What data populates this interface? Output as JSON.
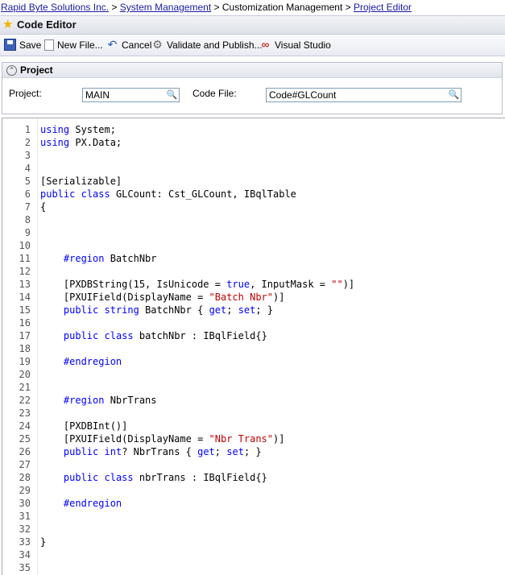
{
  "breadcrumb": {
    "crumb1": "Rapid Byte Solutions Inc.",
    "crumb2": "System Management",
    "crumb3": "Customization Management",
    "crumb4": "Project Editor",
    "separator": ">"
  },
  "header": {
    "title": "Code Editor"
  },
  "toolbar": {
    "save": "Save",
    "new_file": "New File...",
    "cancel": "Cancel",
    "validate": "Validate and Publish...",
    "visual_studio": "Visual Studio"
  },
  "project_panel": {
    "title": "Project",
    "project_label": "Project:",
    "project_value": "MAIN",
    "code_file_label": "Code File:",
    "code_file_value": "Code#GLCount"
  },
  "colors": {
    "keyword": "#0000ff",
    "string": "#c00000",
    "link": "#1a1aa6"
  },
  "code_lines": [
    [
      [
        "kw",
        "using"
      ],
      [
        "pl",
        " System;"
      ]
    ],
    [
      [
        "kw",
        "using"
      ],
      [
        "pl",
        " PX.Data;"
      ]
    ],
    [],
    [],
    [
      [
        "pl",
        "[Serializable]"
      ]
    ],
    [
      [
        "kw",
        "public"
      ],
      [
        "pl",
        " "
      ],
      [
        "kw",
        "class"
      ],
      [
        "pl",
        " GLCount: Cst_GLCount, IBqlTable"
      ]
    ],
    [
      [
        "pl",
        "{"
      ]
    ],
    [],
    [],
    [],
    [
      [
        "pl",
        "    "
      ],
      [
        "kw",
        "#region"
      ],
      [
        "pl",
        " BatchNbr"
      ]
    ],
    [],
    [
      [
        "pl",
        "    [PXDBString(15, IsUnicode = "
      ],
      [
        "kw",
        "true"
      ],
      [
        "pl",
        ", InputMask = "
      ],
      [
        "str",
        "\"\""
      ],
      [
        "pl",
        ")]"
      ]
    ],
    [
      [
        "pl",
        "    [PXUIField(DisplayName = "
      ],
      [
        "str",
        "\"Batch Nbr\""
      ],
      [
        "pl",
        ")]"
      ]
    ],
    [
      [
        "pl",
        "    "
      ],
      [
        "kw",
        "public"
      ],
      [
        "pl",
        " "
      ],
      [
        "kw",
        "string"
      ],
      [
        "pl",
        " BatchNbr { "
      ],
      [
        "kw",
        "get"
      ],
      [
        "pl",
        "; "
      ],
      [
        "kw",
        "set"
      ],
      [
        "pl",
        "; }"
      ]
    ],
    [],
    [
      [
        "pl",
        "    "
      ],
      [
        "kw",
        "public"
      ],
      [
        "pl",
        " "
      ],
      [
        "kw",
        "class"
      ],
      [
        "pl",
        " batchNbr : IBqlField{}"
      ]
    ],
    [],
    [
      [
        "pl",
        "    "
      ],
      [
        "kw",
        "#endregion"
      ]
    ],
    [],
    [],
    [
      [
        "pl",
        "    "
      ],
      [
        "kw",
        "#region"
      ],
      [
        "pl",
        " NbrTrans"
      ]
    ],
    [],
    [
      [
        "pl",
        "    [PXDBInt()]"
      ]
    ],
    [
      [
        "pl",
        "    [PXUIField(DisplayName = "
      ],
      [
        "str",
        "\"Nbr Trans\""
      ],
      [
        "pl",
        ")]"
      ]
    ],
    [
      [
        "pl",
        "    "
      ],
      [
        "kw",
        "public"
      ],
      [
        "pl",
        " "
      ],
      [
        "kw",
        "int"
      ],
      [
        "pl",
        "? NbrTrans { "
      ],
      [
        "kw",
        "get"
      ],
      [
        "pl",
        "; "
      ],
      [
        "kw",
        "set"
      ],
      [
        "pl",
        "; }"
      ]
    ],
    [],
    [
      [
        "pl",
        "    "
      ],
      [
        "kw",
        "public"
      ],
      [
        "pl",
        " "
      ],
      [
        "kw",
        "class"
      ],
      [
        "pl",
        " nbrTrans : IBqlField{}"
      ]
    ],
    [],
    [
      [
        "pl",
        "    "
      ],
      [
        "kw",
        "#endregion"
      ]
    ],
    [],
    [],
    [
      [
        "pl",
        "}"
      ]
    ],
    [],
    []
  ]
}
